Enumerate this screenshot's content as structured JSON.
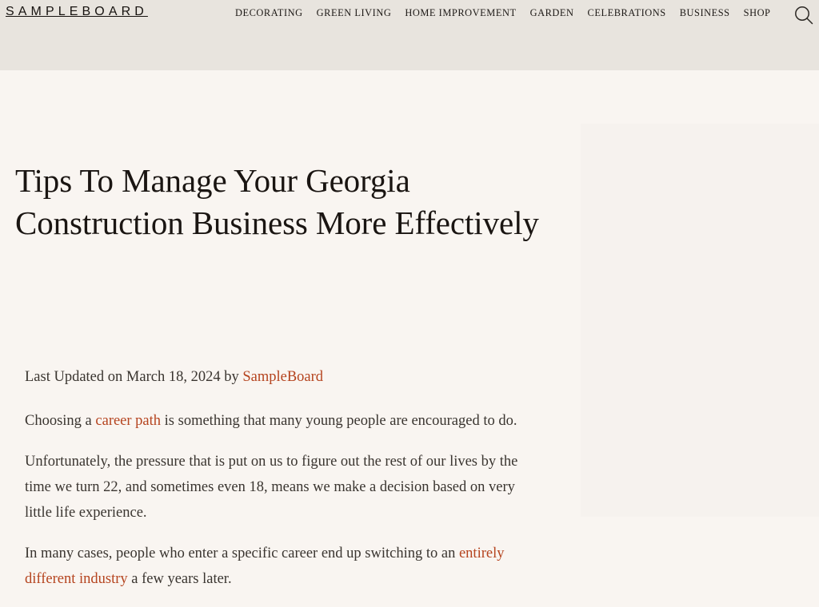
{
  "header": {
    "logo": "SAMPLEBOARD",
    "nav": [
      {
        "label": "DECORATING"
      },
      {
        "label": "GREEN LIVING"
      },
      {
        "label": "HOME IMPROVEMENT"
      },
      {
        "label": "GARDEN"
      },
      {
        "label": "CELEBRATIONS"
      },
      {
        "label": "BUSINESS"
      },
      {
        "label": "SHOP"
      }
    ],
    "search_icon": "search-icon",
    "background_color": "#e8e4de"
  },
  "article": {
    "title": "Tips To Manage Your Georgia Construction Business More Effectively",
    "meta": {
      "prefix": "Last Updated on ",
      "date": "March 18, 2024",
      "by": " by ",
      "author": "SampleBoard"
    },
    "paragraphs": [
      {
        "before": "Choosing a ",
        "link": "career path",
        "after": " is something that many young people are encouraged to do."
      },
      {
        "text": "Unfortunately, the pressure that is put on us to figure out the rest of our lives by the time we turn 22, and sometimes even 18, means we make a decision based on very little life experience."
      },
      {
        "before": "In many cases, people who enter a specific career end up switching to an ",
        "link": "entirely different industry",
        "after": " a few years later."
      }
    ]
  },
  "colors": {
    "page_background": "#f9f5f1",
    "panel_background": "#f6f2ee",
    "link": "#b5441f",
    "text": "#3a3530",
    "heading": "#1a1512"
  }
}
